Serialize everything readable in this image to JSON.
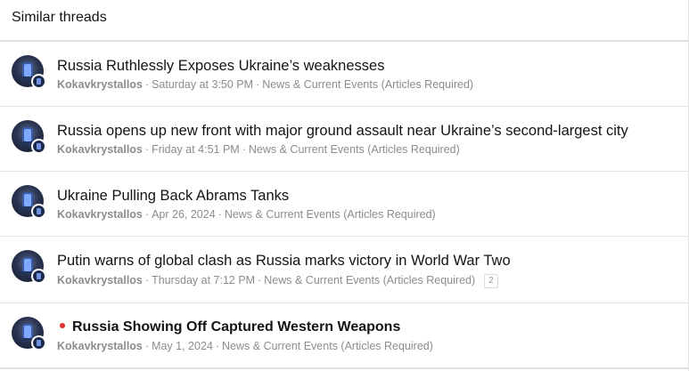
{
  "block": {
    "header": "Similar threads"
  },
  "threads": [
    {
      "title": "Russia Ruthlessly Exposes Ukraine’s weaknesses",
      "author": "Kokavkrystallos",
      "date": "Saturday at 3:50 PM",
      "forum": "News & Current Events (Articles Required)"
    },
    {
      "title": "Russia opens up new front with major ground assault near Ukraine’s second-largest city",
      "author": "Kokavkrystallos",
      "date": "Friday at 4:51 PM",
      "forum": "News & Current Events (Articles Required)"
    },
    {
      "title": "Ukraine Pulling Back Abrams Tanks",
      "author": "Kokavkrystallos",
      "date": "Apr 26, 2024",
      "forum": "News & Current Events (Articles Required)"
    },
    {
      "title": "Putin warns of global clash as Russia marks victory in World War Two",
      "author": "Kokavkrystallos",
      "date": "Thursday at 7:12 PM",
      "forum": "News & Current Events (Articles Required)",
      "replies": "2"
    },
    {
      "title": "Russia Showing Off Captured Western Weapons",
      "author": "Kokavkrystallos",
      "date": "May 1, 2024",
      "forum": "News & Current Events (Articles Required)",
      "unread": true
    }
  ],
  "separator": "·",
  "colors": {
    "text": "#141414",
    "meta": "#8c8c8c",
    "border": "#e2e2e2",
    "unread_dot": "#e03030"
  },
  "icons": {
    "avatar": "throne-avatar-icon",
    "badge": "user-badge-icon",
    "unread": "unread-dot-icon"
  }
}
